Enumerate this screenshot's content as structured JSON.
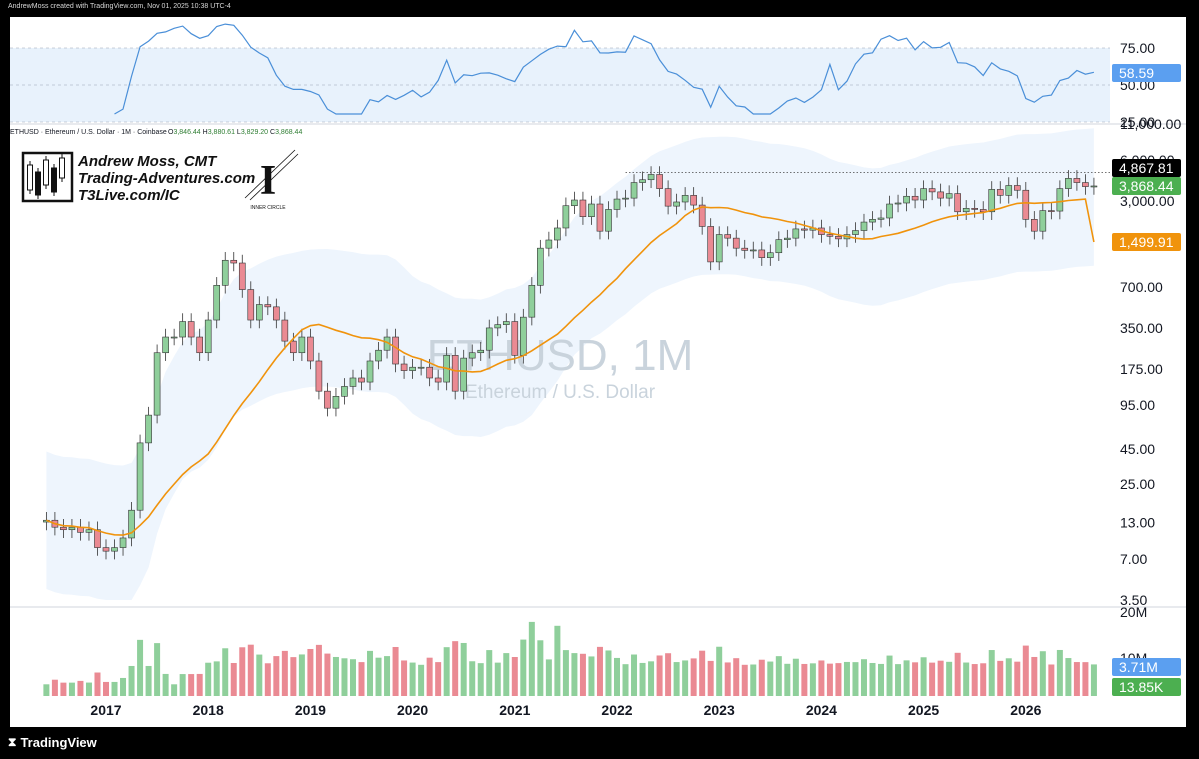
{
  "credit": "AndrewMoss created with TradingView.com, Nov 01, 2025 10:38 UTC-4",
  "symbol_line": "ETHUSD · Ethereum / U.S. Dollar · 1M · Coinbase",
  "ohlc": {
    "o_label": "O",
    "o": "3,846.44",
    "h_label": "H",
    "h": "3,880.61",
    "l_label": "L",
    "l": "3,829.20",
    "c_label": "C",
    "c": "3,868.44"
  },
  "watermark": {
    "title": "ETHUSD, 1M",
    "subtitle": "Ethereum / U.S. Dollar"
  },
  "author": {
    "name": "Andrew Moss, CMT",
    "site": "Trading-Adventures.com",
    "site2": "T3Live.com/IC",
    "badge": "INNER CIRCLE"
  },
  "brand": "TradingView",
  "colors": {
    "up": "#8fcf9b",
    "down": "#ea8a93",
    "sma": "#f0930c",
    "rsi": "#4a8fd8",
    "band": "#e8f2fc"
  },
  "rsi_axis": [
    "75.00",
    "50.00",
    "25.00"
  ],
  "price_axis": [
    "11,000.00",
    "6,000.00",
    "3,000.00",
    "700.00",
    "350.00",
    "175.00",
    "95.00",
    "45.00",
    "25.00",
    "13.00",
    "7.00",
    "3.50"
  ],
  "vol_axis": [
    "20M",
    "10M"
  ],
  "year_labels": [
    "2017",
    "2018",
    "2019",
    "2020",
    "2021",
    "2022",
    "2023",
    "2024",
    "2025",
    "2026"
  ],
  "price_tags": [
    {
      "text": "4,867.81",
      "bg": "#000000"
    },
    {
      "text": "3,868.44",
      "bg": "#4caf50"
    },
    {
      "text": "1,499.91",
      "bg": "#f0930c"
    }
  ],
  "rsi_tag": {
    "text": "58.59",
    "bg": "#5b9ff0"
  },
  "vol_tags": [
    {
      "text": "3.71M",
      "bg": "#5b9ff0"
    },
    {
      "text": "13.85K",
      "bg": "#4caf50"
    }
  ],
  "chart_data": {
    "type": "candlestick",
    "timeframe": "1M",
    "x_start": "2016-06",
    "candles_closes": [
      13.5,
      12,
      11.5,
      12,
      11,
      11.5,
      8.5,
      8,
      8.5,
      10,
      16,
      50,
      80,
      230,
      300,
      300,
      390,
      300,
      230,
      400,
      720,
      1100,
      1050,
      670,
      400,
      520,
      500,
      400,
      280,
      230,
      300,
      200,
      120,
      90,
      110,
      130,
      150,
      140,
      200,
      240,
      300,
      190,
      170,
      180,
      180,
      150,
      140,
      220,
      120,
      210,
      230,
      240,
      350,
      370,
      390,
      220,
      420,
      720,
      1350,
      1550,
      1900,
      2770,
      3050,
      2300,
      2850,
      1800,
      2600,
      3100,
      3150,
      4100,
      4300,
      4700,
      3700,
      2750,
      2950,
      3300,
      2800,
      1950,
      1070,
      1700,
      1600,
      1350,
      1300,
      1310,
      1150,
      1250,
      1560,
      1600,
      1870,
      1830,
      1900,
      1700,
      1650,
      1580,
      1700,
      1820,
      2100,
      2200,
      2250,
      2850,
      2900,
      3250,
      3050,
      3700,
      3500,
      3150,
      3400,
      2500,
      2650,
      2600,
      2500,
      3650,
      3300,
      3900,
      3600,
      2200,
      1800,
      2550,
      2530,
      3700,
      4400,
      4100,
      3830,
      3868.44
    ],
    "sma": {
      "name": "",
      "last": 1499.91
    },
    "horizontal_line": 4867.81,
    "rsi": {
      "last": 58.59,
      "levels": [
        75,
        50,
        25
      ]
    },
    "volume": {
      "last": "3.71M",
      "last2": "13.85K"
    },
    "y_scale": "log"
  }
}
